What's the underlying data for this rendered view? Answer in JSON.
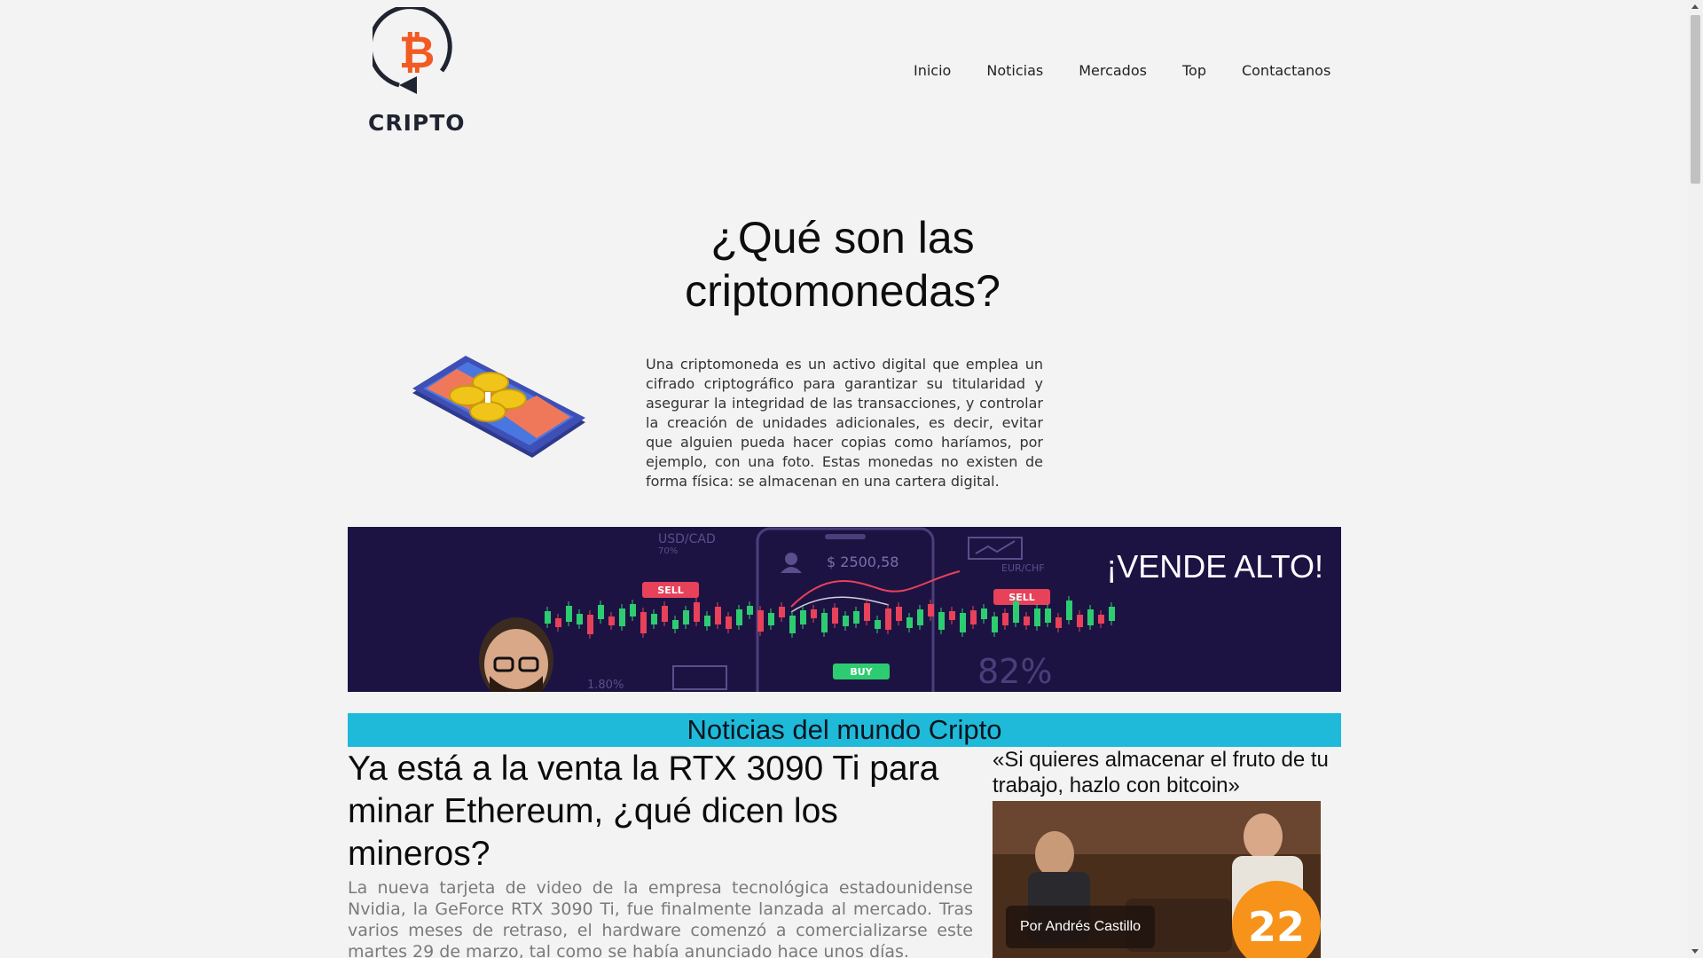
{
  "brand": {
    "name": "CRIPTO",
    "logo_icon": "bitcoin-refresh-icon",
    "accent": "#f15a22"
  },
  "nav": {
    "items": [
      {
        "label": "Inicio"
      },
      {
        "label": "Noticias"
      },
      {
        "label": "Mercados"
      },
      {
        "label": "Top"
      },
      {
        "label": "Contactanos"
      }
    ]
  },
  "intro": {
    "title": "¿Qué son las criptomonedas?",
    "text": "Una criptomoneda es un activo digital que emplea un cifrado criptográfico para garantizar su titularidad y asegurar la integridad de las transacciones, y controlar la creación de unidades adicionales, es decir, evitar que alguien pueda hacer copias como haríamos, por ejemplo, con una foto. Estas monedas no existen de forma física: se almacenan en una cartera digital.",
    "illustration": "phone-coins-illustration"
  },
  "banner": {
    "headline": "¡VENDE ALTO!",
    "labels": {
      "pair1": "USD/CAD",
      "pair1_pct": "70%",
      "pair2": "EUR/CHF",
      "price": "$ 2500,58",
      "sell": "SELL",
      "buy": "BUY",
      "percent": "82%",
      "small_pct": "1.80%"
    },
    "background": "#1d1343"
  },
  "news": {
    "section_title": "Noticias del mundo Cripto",
    "section_color": "#1fbad9",
    "main": {
      "title": "Ya está a la venta la RTX 3090 Ti para minar Ethereum, ¿qué dicen los mineros?",
      "body": "La nueva tarjeta de video de la empresa tecnológica estadounidense Nvidia, la GeForce RTX 3090 Ti, fue finalmente lanzada al mercado. Tras varios meses de retraso, el hardware comenzó a comercializarse este martes 29 de marzo, tal como se había anunciado hace unos días."
    },
    "side": {
      "title": "«Si quieres almacenar el fruto de tu trabajo, hazlo con bitcoin»",
      "author": "Por Andrés Castillo",
      "badge_text": "22"
    }
  }
}
